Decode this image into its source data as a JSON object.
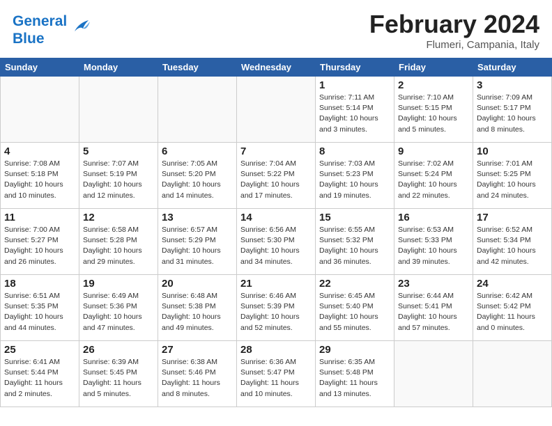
{
  "header": {
    "logo_line1": "General",
    "logo_line2": "Blue",
    "month": "February 2024",
    "location": "Flumeri, Campania, Italy"
  },
  "weekdays": [
    "Sunday",
    "Monday",
    "Tuesday",
    "Wednesday",
    "Thursday",
    "Friday",
    "Saturday"
  ],
  "weeks": [
    [
      {
        "day": "",
        "info": ""
      },
      {
        "day": "",
        "info": ""
      },
      {
        "day": "",
        "info": ""
      },
      {
        "day": "",
        "info": ""
      },
      {
        "day": "1",
        "info": "Sunrise: 7:11 AM\nSunset: 5:14 PM\nDaylight: 10 hours\nand 3 minutes."
      },
      {
        "day": "2",
        "info": "Sunrise: 7:10 AM\nSunset: 5:15 PM\nDaylight: 10 hours\nand 5 minutes."
      },
      {
        "day": "3",
        "info": "Sunrise: 7:09 AM\nSunset: 5:17 PM\nDaylight: 10 hours\nand 8 minutes."
      }
    ],
    [
      {
        "day": "4",
        "info": "Sunrise: 7:08 AM\nSunset: 5:18 PM\nDaylight: 10 hours\nand 10 minutes."
      },
      {
        "day": "5",
        "info": "Sunrise: 7:07 AM\nSunset: 5:19 PM\nDaylight: 10 hours\nand 12 minutes."
      },
      {
        "day": "6",
        "info": "Sunrise: 7:05 AM\nSunset: 5:20 PM\nDaylight: 10 hours\nand 14 minutes."
      },
      {
        "day": "7",
        "info": "Sunrise: 7:04 AM\nSunset: 5:22 PM\nDaylight: 10 hours\nand 17 minutes."
      },
      {
        "day": "8",
        "info": "Sunrise: 7:03 AM\nSunset: 5:23 PM\nDaylight: 10 hours\nand 19 minutes."
      },
      {
        "day": "9",
        "info": "Sunrise: 7:02 AM\nSunset: 5:24 PM\nDaylight: 10 hours\nand 22 minutes."
      },
      {
        "day": "10",
        "info": "Sunrise: 7:01 AM\nSunset: 5:25 PM\nDaylight: 10 hours\nand 24 minutes."
      }
    ],
    [
      {
        "day": "11",
        "info": "Sunrise: 7:00 AM\nSunset: 5:27 PM\nDaylight: 10 hours\nand 26 minutes."
      },
      {
        "day": "12",
        "info": "Sunrise: 6:58 AM\nSunset: 5:28 PM\nDaylight: 10 hours\nand 29 minutes."
      },
      {
        "day": "13",
        "info": "Sunrise: 6:57 AM\nSunset: 5:29 PM\nDaylight: 10 hours\nand 31 minutes."
      },
      {
        "day": "14",
        "info": "Sunrise: 6:56 AM\nSunset: 5:30 PM\nDaylight: 10 hours\nand 34 minutes."
      },
      {
        "day": "15",
        "info": "Sunrise: 6:55 AM\nSunset: 5:32 PM\nDaylight: 10 hours\nand 36 minutes."
      },
      {
        "day": "16",
        "info": "Sunrise: 6:53 AM\nSunset: 5:33 PM\nDaylight: 10 hours\nand 39 minutes."
      },
      {
        "day": "17",
        "info": "Sunrise: 6:52 AM\nSunset: 5:34 PM\nDaylight: 10 hours\nand 42 minutes."
      }
    ],
    [
      {
        "day": "18",
        "info": "Sunrise: 6:51 AM\nSunset: 5:35 PM\nDaylight: 10 hours\nand 44 minutes."
      },
      {
        "day": "19",
        "info": "Sunrise: 6:49 AM\nSunset: 5:36 PM\nDaylight: 10 hours\nand 47 minutes."
      },
      {
        "day": "20",
        "info": "Sunrise: 6:48 AM\nSunset: 5:38 PM\nDaylight: 10 hours\nand 49 minutes."
      },
      {
        "day": "21",
        "info": "Sunrise: 6:46 AM\nSunset: 5:39 PM\nDaylight: 10 hours\nand 52 minutes."
      },
      {
        "day": "22",
        "info": "Sunrise: 6:45 AM\nSunset: 5:40 PM\nDaylight: 10 hours\nand 55 minutes."
      },
      {
        "day": "23",
        "info": "Sunrise: 6:44 AM\nSunset: 5:41 PM\nDaylight: 10 hours\nand 57 minutes."
      },
      {
        "day": "24",
        "info": "Sunrise: 6:42 AM\nSunset: 5:42 PM\nDaylight: 11 hours\nand 0 minutes."
      }
    ],
    [
      {
        "day": "25",
        "info": "Sunrise: 6:41 AM\nSunset: 5:44 PM\nDaylight: 11 hours\nand 2 minutes."
      },
      {
        "day": "26",
        "info": "Sunrise: 6:39 AM\nSunset: 5:45 PM\nDaylight: 11 hours\nand 5 minutes."
      },
      {
        "day": "27",
        "info": "Sunrise: 6:38 AM\nSunset: 5:46 PM\nDaylight: 11 hours\nand 8 minutes."
      },
      {
        "day": "28",
        "info": "Sunrise: 6:36 AM\nSunset: 5:47 PM\nDaylight: 11 hours\nand 10 minutes."
      },
      {
        "day": "29",
        "info": "Sunrise: 6:35 AM\nSunset: 5:48 PM\nDaylight: 11 hours\nand 13 minutes."
      },
      {
        "day": "",
        "info": ""
      },
      {
        "day": "",
        "info": ""
      }
    ]
  ]
}
